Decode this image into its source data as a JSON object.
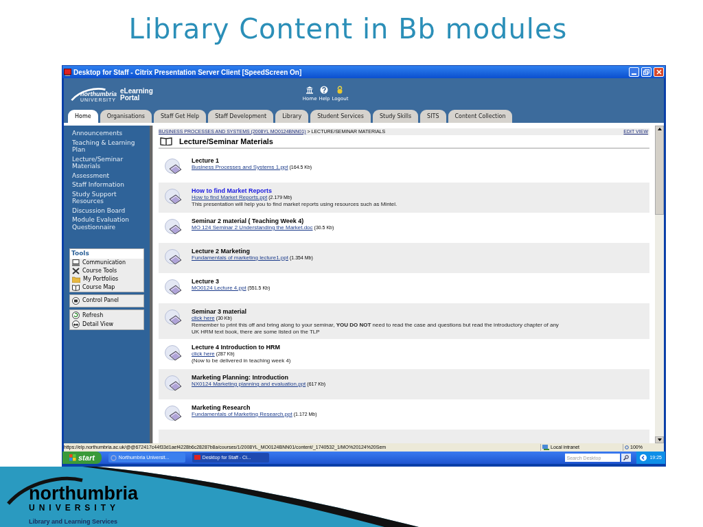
{
  "slide": {
    "title": "Library Content in Bb modules",
    "logo_name": "northumbria",
    "logo_sub": "UNIVERSITY",
    "caption": "Library and Learning Services"
  },
  "window": {
    "title": "Desktop for Staff - Citrix Presentation Server Client [SpeedScreen On]"
  },
  "portal": {
    "logo_name": "northumbria",
    "logo_sub": "UNIVERSITY",
    "brand": [
      "eLearning",
      "Portal"
    ],
    "nav": [
      {
        "kind": "home",
        "label": "Home"
      },
      {
        "kind": "help",
        "label": "Help"
      },
      {
        "kind": "logout",
        "label": "Logout"
      }
    ]
  },
  "tabs": [
    {
      "label": "Home",
      "selected": true
    },
    {
      "label": "Organisations",
      "selected": false
    },
    {
      "label": "Staff Get Help",
      "selected": false
    },
    {
      "label": "Staff Development",
      "selected": false
    },
    {
      "label": "Library",
      "selected": false
    },
    {
      "label": "Student Services",
      "selected": false
    },
    {
      "label": "Study Skills",
      "selected": false
    },
    {
      "label": "SITS",
      "selected": false
    },
    {
      "label": "Content Collection",
      "selected": false
    }
  ],
  "sidebar": {
    "items": [
      "Announcements",
      "Teaching & Learning Plan",
      "Lecture/Seminar Materials",
      "Assessment",
      "Staff Information",
      "Study Support Resources",
      "Discussion Board",
      "Module Evaluation Questionnaire"
    ],
    "tools_title": "Tools",
    "tools": [
      {
        "kind": "communication",
        "label": "Communication"
      },
      {
        "kind": "course-tools",
        "label": "Course Tools"
      },
      {
        "kind": "portfolios",
        "label": "My Portfolios"
      },
      {
        "kind": "map",
        "label": "Course Map"
      }
    ],
    "control_panel": "Control Panel",
    "actions": [
      {
        "kind": "refresh",
        "label": "Refresh"
      },
      {
        "kind": "detail",
        "label": "Detail View"
      }
    ]
  },
  "breadcrumb": {
    "path": "BUSINESS PROCESSES AND SYSTEMS (2008YL MO0124BNN01)",
    "current": "> LECTURE/SEMINAR MATERIALS",
    "edit_view": "EDIT VIEW"
  },
  "page_title": "Lecture/Seminar Materials",
  "items": [
    {
      "title": "Lecture 1",
      "title_link": false,
      "file": "Business Processes and Systems 1.ppt",
      "size": "(164.5 Kb)"
    },
    {
      "title": "How to find Market Reports",
      "title_link": true,
      "file": "How to find Market Reports.ppt",
      "size": "(2.179 Mb)",
      "description": "This presentation will help you to find market reports using resources such as Mintel."
    },
    {
      "title": "Seminar 2 material ( Teaching Week 4)",
      "title_link": false,
      "file": "MO 124 Seminar 2 Understanding the Market.doc",
      "size": "(30.5 Kb)"
    },
    {
      "title": "Lecture 2 Marketing",
      "title_link": false,
      "file": "Fundamentals of marketing lecture1.ppt",
      "size": "(1.354 Mb)"
    },
    {
      "title": "Lecture 3",
      "title_link": false,
      "file": "MO0124 Lecture 4.ppt",
      "size": "(551.5 Kb)"
    },
    {
      "title": "Seminar 3 material",
      "title_link": false,
      "file": "click here",
      "size": "(30 Kb)",
      "description": "Remember to print this off and bring along to your seminar, **YOU DO NOT** need to read the case and questions but read the introductory chapter of any UK HRM text book, there are some listed on the TLP"
    },
    {
      "title": "Lecture 4 Introduction to HRM",
      "title_link": false,
      "file": "click here",
      "size": "(287 Kb)",
      "description": "(Now to be delivered in teaching week 4)"
    },
    {
      "title": "Marketing Planning: Introduction",
      "title_link": false,
      "file": "NX0124 Marketing planning and evaluation.ppt",
      "size": "(617 Kb)"
    },
    {
      "title": "Marketing Research",
      "title_link": false,
      "file": "Fundamentals of Marketing Research.ppt",
      "size": "(1.172 Mb)"
    }
  ],
  "status_bar": {
    "url": "https://elp.northumbria.ac.uk/@@672417c44f33d1aef4228b6c28287b8a/courses/1/2008YL_MO0124BNN01/content/_1740532_1/MO%20124%20Sem",
    "zone": "Local intranet",
    "zoom": "100%"
  },
  "taskbar": {
    "start": "start",
    "tasks": [
      "Northumbria Universit...",
      "Desktop for Staff - Ci..."
    ],
    "search_placeholder": "Search Desktop",
    "clock": "19:25"
  }
}
